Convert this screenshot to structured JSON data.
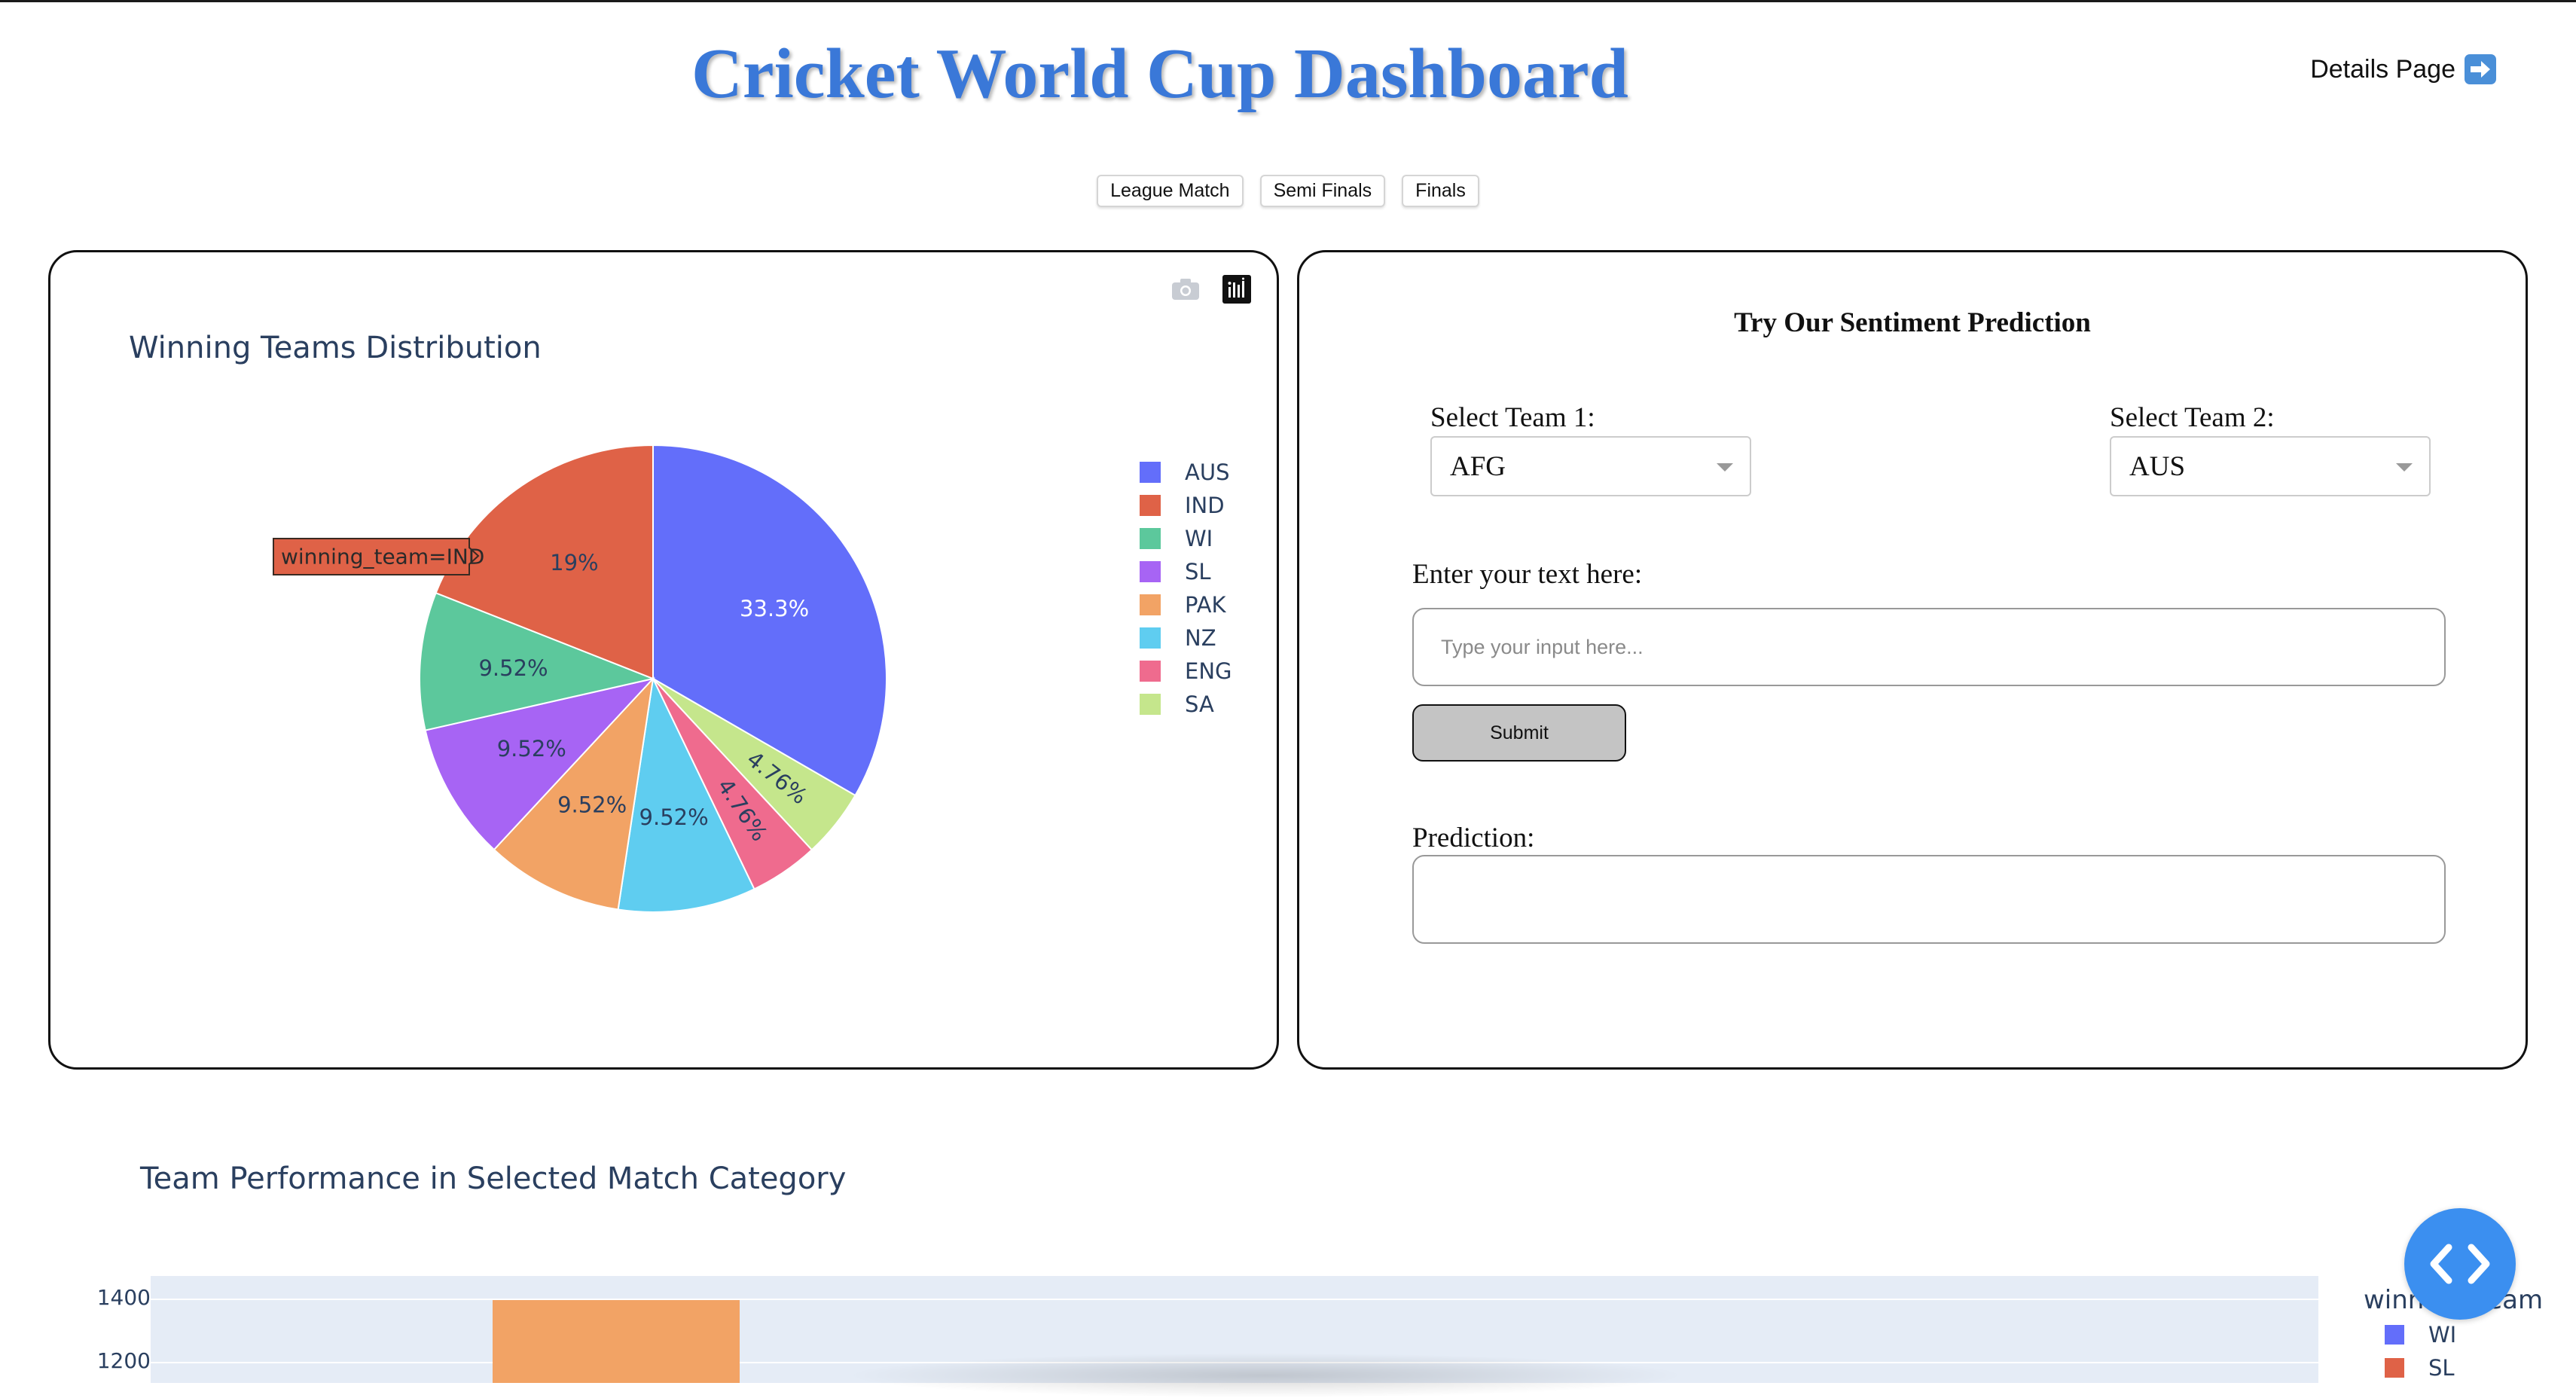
{
  "header": {
    "title": "Cricket World Cup Dashboard",
    "details_link": "Details Page"
  },
  "tabs": [
    "League Match",
    "Semi Finals",
    "Finals"
  ],
  "pie_chart": {
    "title": "Winning Teams Distribution",
    "tooltip": "winning_team=IND",
    "modebar": [
      "camera-icon",
      "plotly-logo-icon"
    ]
  },
  "chart_data": [
    {
      "type": "pie",
      "title": "Winning Teams Distribution",
      "legend_position": "right",
      "slices": [
        {
          "label": "AUS",
          "value": 33.3,
          "text": "33.3%",
          "color": "#636efa"
        },
        {
          "label": "SA",
          "value": 4.76,
          "text": "4.76%",
          "color": "#c5e68c"
        },
        {
          "label": "ENG",
          "value": 4.76,
          "text": "4.76%",
          "color": "#ef6b8e"
        },
        {
          "label": "NZ",
          "value": 9.52,
          "text": "9.52%",
          "color": "#5fcdf0"
        },
        {
          "label": "PAK",
          "value": 9.52,
          "text": "9.52%",
          "color": "#f2a365"
        },
        {
          "label": "SL",
          "value": 9.52,
          "text": "9.52%",
          "color": "#a764f4"
        },
        {
          "label": "WI",
          "value": 9.52,
          "text": "9.52%",
          "color": "#5cc89c"
        },
        {
          "label": "IND",
          "value": 19.0,
          "text": "19%",
          "color": "#df6247"
        }
      ],
      "legend_order": [
        "AUS",
        "IND",
        "WI",
        "SL",
        "PAK",
        "NZ",
        "ENG",
        "SA"
      ]
    },
    {
      "type": "bar",
      "title": "Team Performance in Selected Match Category",
      "y_ticks": [
        1400,
        1200
      ],
      "legend_title": "winning_team",
      "legend": [
        {
          "label": "WI",
          "color": "#636efa"
        },
        {
          "label": "SL",
          "color": "#df6247"
        }
      ],
      "visible_bars": [
        {
          "color": "#f2a365",
          "top_value": 1400
        }
      ]
    }
  ],
  "prediction_panel": {
    "title": "Try Our Sentiment Prediction",
    "team1_label": "Select Team 1:",
    "team1_value": "AFG",
    "team2_label": "Select Team 2:",
    "team2_value": "AUS",
    "text_label": "Enter your text here:",
    "text_placeholder": "Type your input here...",
    "submit_label": "Submit",
    "prediction_label": "Prediction:",
    "prediction_value": ""
  }
}
